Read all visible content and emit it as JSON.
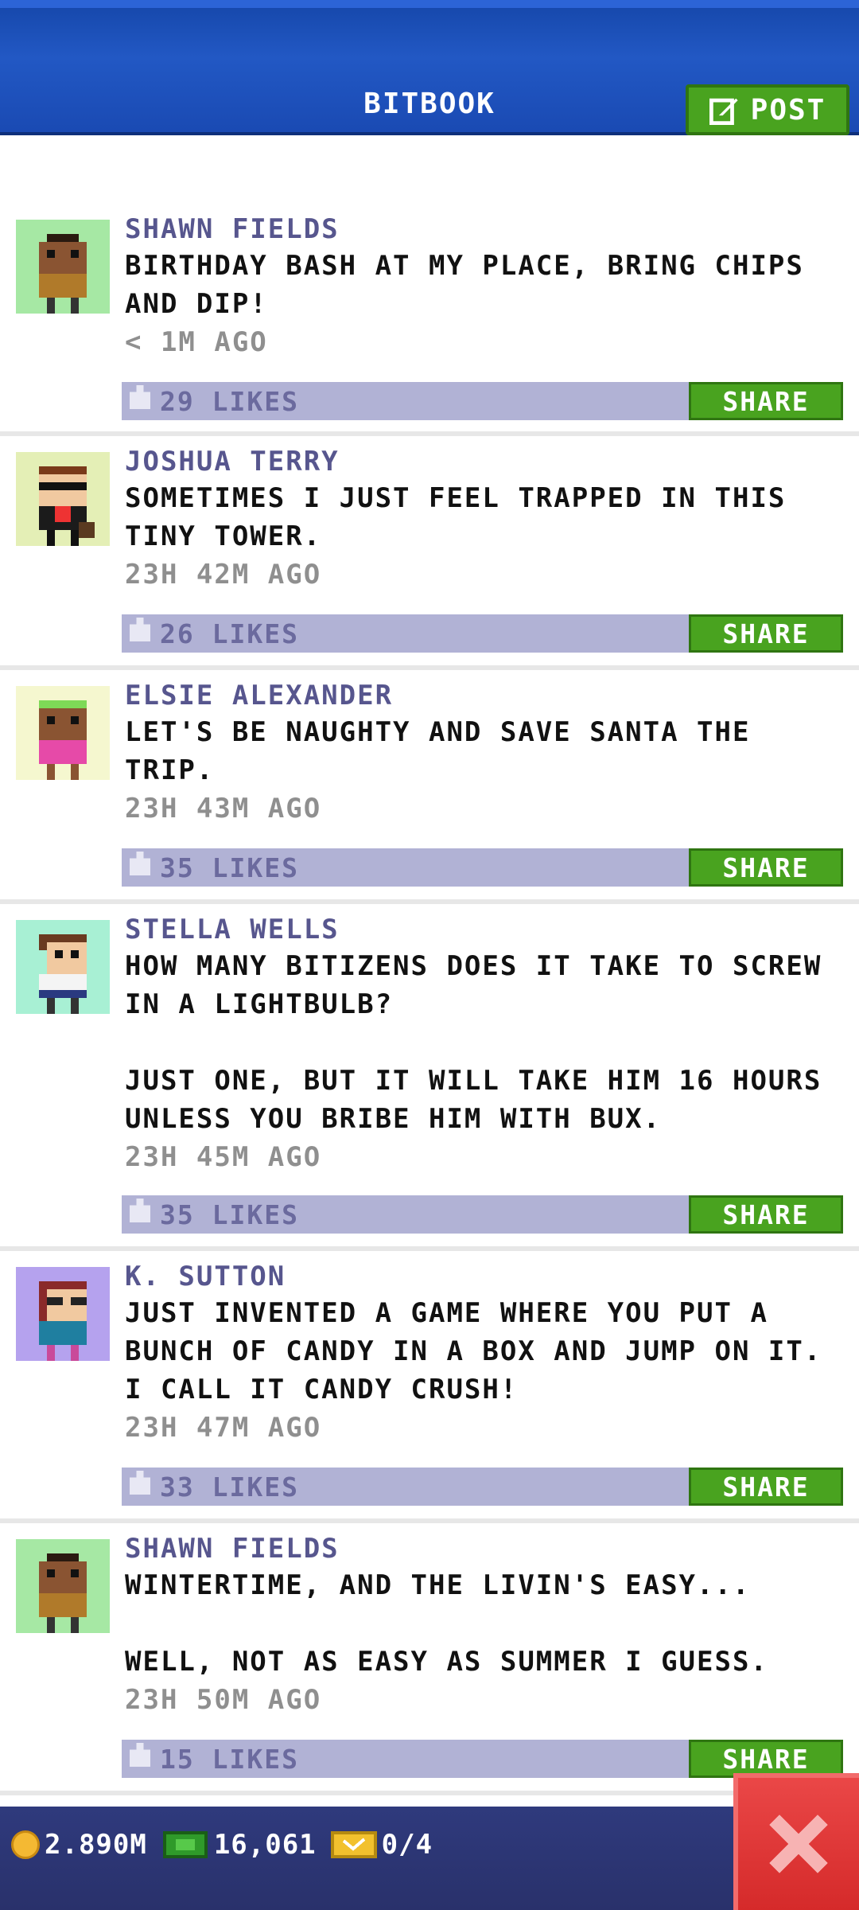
{
  "header": {
    "title": "BITBOOK",
    "post_label": "POST"
  },
  "colors": {
    "header_blue": "#1a4ab3",
    "green_button": "#49a31f",
    "like_bar": "#b1b2d5",
    "author_text": "#57568e",
    "close_red": "#e03a3a",
    "bottom_bar": "#2c3573"
  },
  "posts": [
    {
      "author": "SHAWN FIELDS",
      "text": "BIRTHDAY BASH AT MY PLACE, BRING CHIPS AND DIP!",
      "time": "< 1M AGO",
      "likes": "29 LIKES",
      "share": "SHARE",
      "avatar_bg": "#a6e8a4",
      "avatar": "brown-guy-icon"
    },
    {
      "author": "JOSHUA TERRY",
      "text": "SOMETIMES I JUST FEEL TRAPPED IN THIS TINY TOWER.",
      "time": "23H 42M AGO",
      "likes": "26 LIKES",
      "share": "SHARE",
      "avatar_bg": "#e4efb6",
      "avatar": "sunglasses-guy-icon"
    },
    {
      "author": "ELSIE ALEXANDER",
      "text": "LET'S BE NAUGHTY AND SAVE SANTA THE TRIP.",
      "time": "23H 43M AGO",
      "likes": "35 LIKES",
      "share": "SHARE",
      "avatar_bg": "#f5f7cf",
      "avatar": "green-hair-girl-icon"
    },
    {
      "author": "STELLA WELLS",
      "text": "HOW MANY BITIZENS DOES IT TAKE TO SCREW IN A LIGHTBULB?\n\nJUST ONE, BUT IT WILL TAKE HIM 16 HOURS UNLESS YOU BRIBE HIM WITH BUX.",
      "time": "23H 45M AGO",
      "likes": "35 LIKES",
      "share": "SHARE",
      "avatar_bg": "#a8f0d4",
      "avatar": "brown-hair-girl-icon"
    },
    {
      "author": "K. SUTTON",
      "text": "JUST INVENTED A GAME WHERE YOU PUT A BUNCH OF CANDY IN A BOX AND JUMP ON IT. I CALL IT CANDY CRUSH!",
      "time": "23H 47M AGO",
      "likes": "33 LIKES",
      "share": "SHARE",
      "avatar_bg": "#b5a2ee",
      "avatar": "glasses-girl-icon"
    },
    {
      "author": "SHAWN FIELDS",
      "text": "WINTERTIME, AND THE LIVIN'S EASY...\n\nWELL, NOT AS EASY AS SUMMER I GUESS.",
      "time": "23H 50M AGO",
      "likes": "15 LIKES",
      "share": "SHARE",
      "avatar_bg": "#a6e8a4",
      "avatar": "brown-guy-icon"
    }
  ],
  "footer": {
    "coins": "2.890M",
    "bux": "16,061",
    "tickets": "0/4"
  }
}
